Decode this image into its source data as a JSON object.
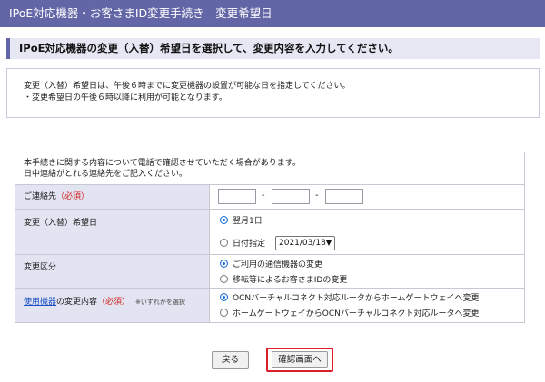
{
  "header": {
    "title": "IPoE対応機器・お客さまID変更手続き　変更希望日"
  },
  "instruction": "IPoE対応機器の変更（入替）希望日を選択して、変更内容を入力してください。",
  "notice": {
    "line1": "変更（入替）希望日は、午後６時までに変更機器の設置が可能な日を指定してください。",
    "line2": "・変更希望日の午後６時以降に利用が可能となります。"
  },
  "form": {
    "intro_line1": "本手続きに関する内容について電話で確認させていただく場合があります。",
    "intro_line2": "日中連絡がとれる連絡先をご記入ください。",
    "contact": {
      "label": "ご連絡先",
      "required": "（必須）",
      "tel1": "",
      "tel2": "",
      "tel3": "",
      "dash": "-"
    },
    "date": {
      "label": "変更（入替）希望日",
      "option1": "翌月1日",
      "option2": "日付指定",
      "selected_date": "2021/03/18"
    },
    "category": {
      "label": "変更区分",
      "option1": "ご利用の通信機器の変更",
      "option2": "移転等によるお客さまIDの変更"
    },
    "device": {
      "label_link": "使用機器",
      "label_rest": "の変更内容",
      "required": "（必須）",
      "note": "※いずれかを選択",
      "option1": "OCNバーチャルコネクト対応ルータからホームゲートウェイへ変更",
      "option2": "ホームゲートウェイからOCNバーチャルコネクト対応ルータへ変更"
    }
  },
  "buttons": {
    "back": "戻る",
    "confirm": "確認画面へ"
  }
}
